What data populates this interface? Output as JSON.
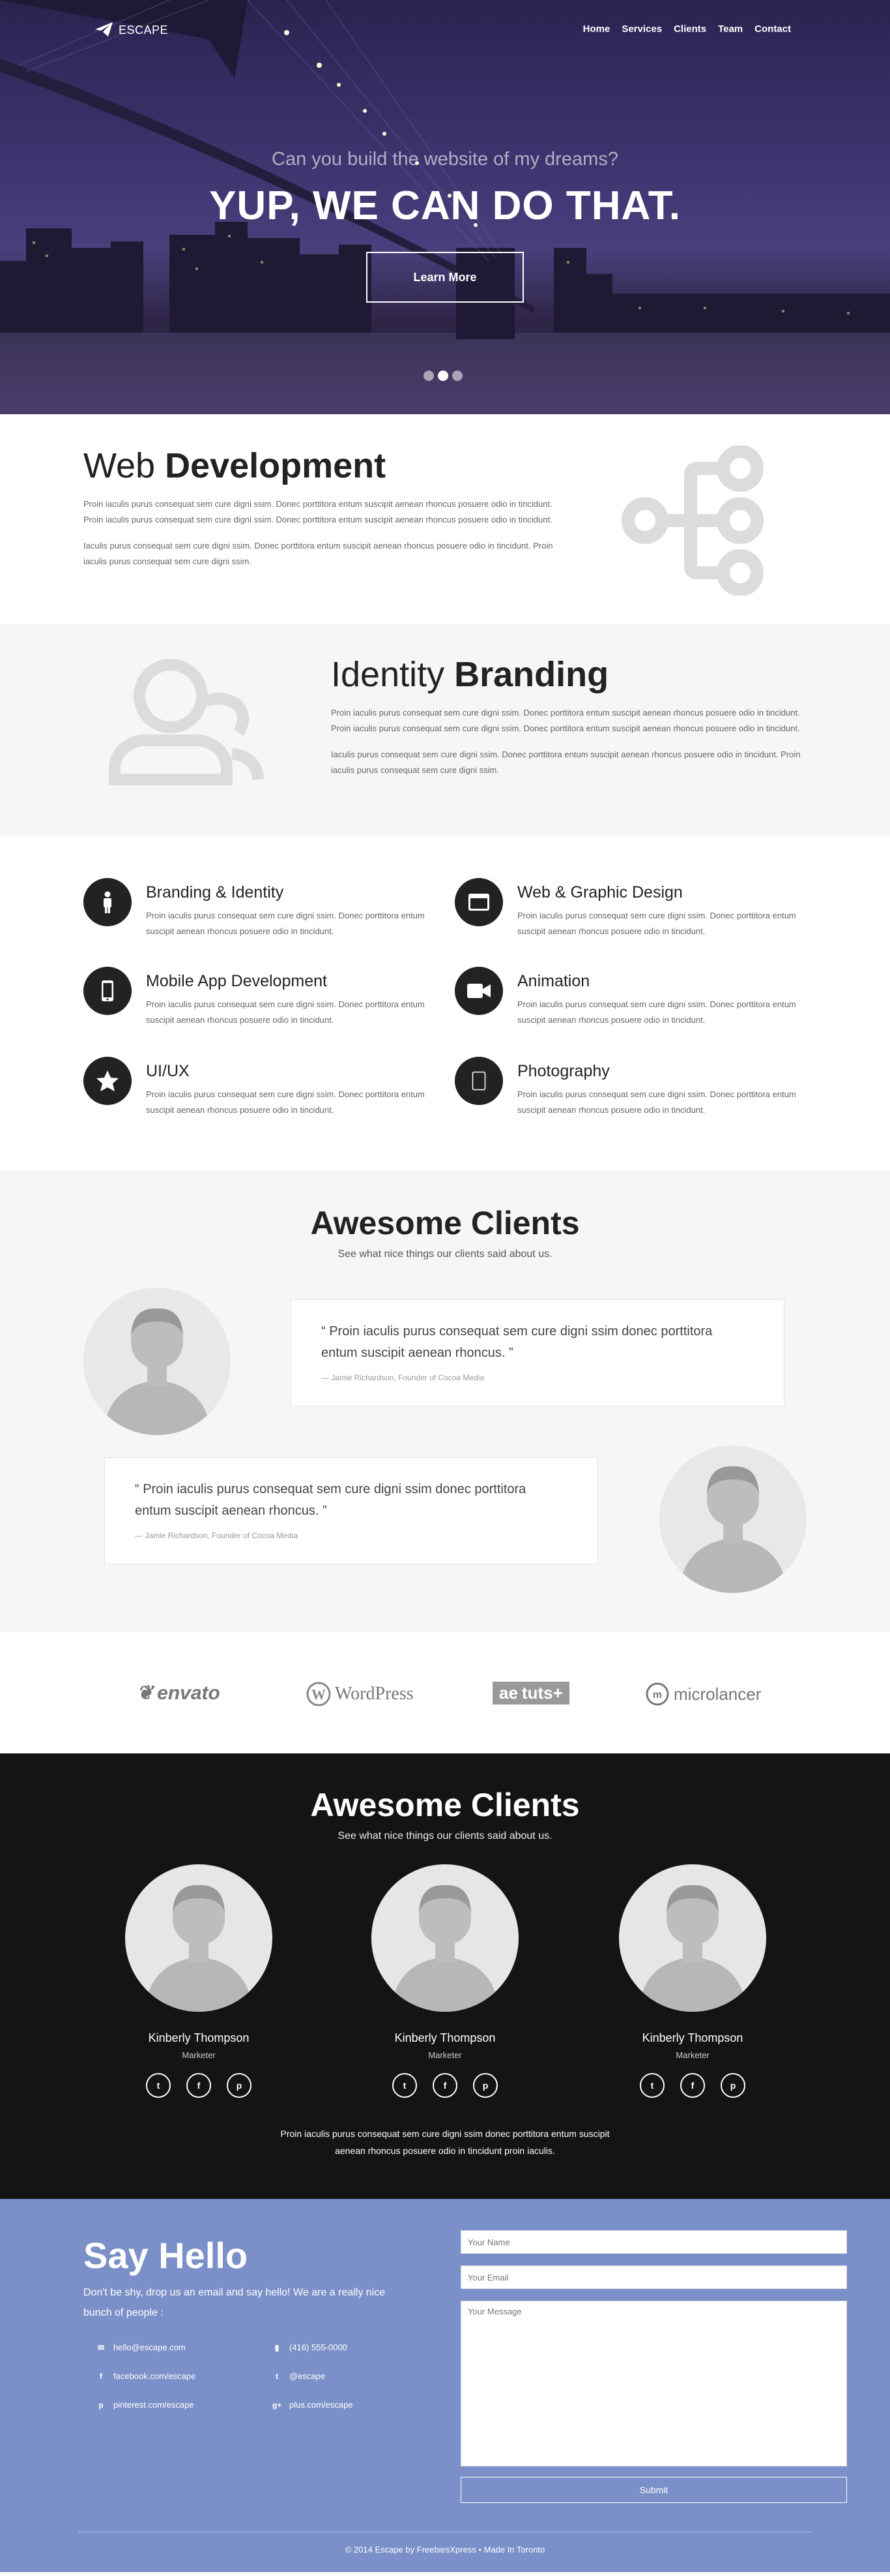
{
  "nav": {
    "logo": "ESCAPE",
    "items": [
      "Home",
      "Services",
      "Clients",
      "Team",
      "Contact"
    ]
  },
  "hero": {
    "subtitle": "Can you build the website of my dreams?",
    "title": "YUP, WE CAN DO THAT.",
    "button": "Learn More",
    "slide_index": 2,
    "slide_count": 3
  },
  "web_dev": {
    "title_light": "Web ",
    "title_bold": "Development",
    "p1": "Proin iaculis purus consequat sem cure digni ssim. Donec porttitora entum suscipit aenean rhoncus posuere odio in tincidunt. Proin iaculis purus consequat sem cure digni ssim. Donec porttitora entum suscipit aenean rhoncus posuere odio in tincidunt.",
    "p2": "Iaculis purus consequat sem cure digni ssim. Donec porttitora entum suscipit aenean rhoncus posuere odio in tincidunt. Proin iaculis purus consequat sem cure digni ssim."
  },
  "identity": {
    "title_light": "Identity ",
    "title_bold": "Branding",
    "p1": "Proin iaculis purus consequat sem cure digni ssim. Donec porttitora entum suscipit aenean rhoncus posuere odio in tincidunt. Proin iaculis purus consequat sem cure digni ssim. Donec porttitora entum suscipit aenean rhoncus posuere odio in tincidunt.",
    "p2": "Iaculis purus consequat sem cure digni ssim. Donec porttitora entum suscipit aenean rhoncus posuere odio in tincidunt. Proin iaculis purus consequat sem cure digni ssim."
  },
  "services": {
    "items": [
      {
        "title": "Branding & Identity",
        "text": "Proin iaculis purus consequat sem cure digni ssim. Donec porttitora entum suscipit aenean rhoncus posuere odio in tincidunt."
      },
      {
        "title": "Web & Graphic Design",
        "text": "Proin iaculis purus consequat sem cure digni ssim. Donec porttitora entum suscipit aenean rhoncus posuere odio in tincidunt."
      },
      {
        "title": "Mobile App Development",
        "text": "Proin iaculis purus consequat sem cure digni ssim. Donec porttitora entum suscipit aenean rhoncus posuere odio in tincidunt."
      },
      {
        "title": "Animation",
        "text": "Proin iaculis purus consequat sem cure digni ssim. Donec porttitora entum suscipit aenean rhoncus posuere odio in tincidunt."
      },
      {
        "title": "UI/UX",
        "text": "Proin iaculis purus consequat sem cure digni ssim. Donec porttitora entum suscipit aenean rhoncus posuere odio in tincidunt."
      },
      {
        "title": "Photography",
        "text": "Proin iaculis purus consequat sem cure digni ssim. Donec porttitora entum suscipit aenean rhoncus posuere odio in tincidunt."
      }
    ]
  },
  "clients": {
    "title": "Awesome Clients",
    "subtitle": "See what nice things our clients said about us.",
    "quotes": [
      {
        "text": "“ Proin iaculis purus consequat sem cure digni ssim donec porttitora entum suscipit aenean rhoncus. ”",
        "author": "— Jamie Richardson, Founder of Cocoa Media"
      },
      {
        "text": "“ Proin iaculis purus consequat sem cure digni ssim donec porttitora entum suscipit aenean rhoncus. ”",
        "author": "— Jamie Richardson, Founder of Cocoa Media"
      }
    ]
  },
  "logos": [
    "envato",
    "WordPress",
    "tuts+",
    "microlancer"
  ],
  "team": {
    "title": "Awesome Clients",
    "subtitle": "See what nice things our clients said about us.",
    "members": [
      {
        "name": "Kinberly Thompson",
        "role": "Marketer"
      },
      {
        "name": "Kinberly Thompson",
        "role": "Marketer"
      },
      {
        "name": "Kinberly Thompson",
        "role": "Marketer"
      }
    ],
    "text": "Proin iaculis purus consequat sem cure digni ssim donec porttitora entum suscipit aenean rhoncus posuere odio in tincidunt proin iaculis."
  },
  "contact": {
    "title_light": "Say ",
    "title_bold": "Hello",
    "text": "Don't be shy, drop us an email and say hello! We are a really nice bunch of people :",
    "email": "hello@escape.com",
    "phone": "(416) 555-0000",
    "facebook": "facebook.com/escape",
    "twitter": "@escape",
    "pinterest": "pinterest.com/escape",
    "gplus": "plus.com/escape",
    "name_placeholder": "Your Name",
    "email_placeholder": "Your Email",
    "message_placeholder": "Your Message",
    "submit": "Submit"
  },
  "footer": "© 2014 Escape by FreebiesXpress • Made In Toronto",
  "colors": {
    "contact_bg": "#7b90c8",
    "team_bg": "#141414",
    "light_bg": "#f5f6f8"
  }
}
